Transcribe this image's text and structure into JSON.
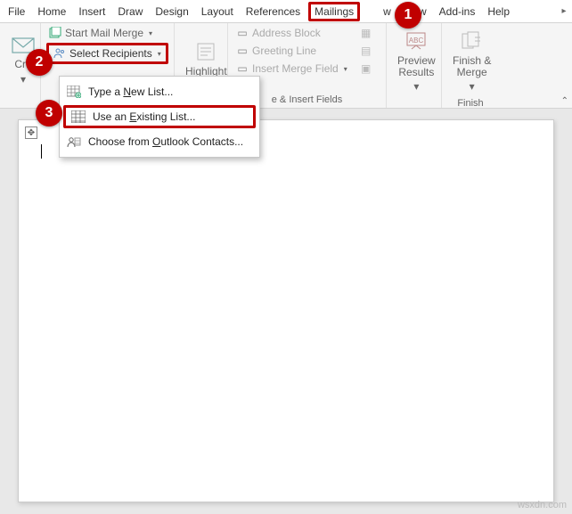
{
  "tabs": {
    "file": "File",
    "home": "Home",
    "insert": "Insert",
    "draw": "Draw",
    "design": "Design",
    "layout": "Layout",
    "references": "References",
    "mailings": "Mailings",
    "view_trunc": "w",
    "view": "View",
    "addins": "Add-ins",
    "help": "Help"
  },
  "ribbon": {
    "create": {
      "label": "Cre"
    },
    "start_group": {
      "start_mail_merge": "Start Mail Merge",
      "select_recipients": "Select Recipients",
      "title_trunc": "e & Insert Fields"
    },
    "highlight": "Highlight",
    "write": {
      "address_block": "Address Block",
      "greeting_line": "Greeting Line",
      "insert_merge_field": "Insert Merge Field"
    },
    "preview": {
      "label": "Preview\nResults",
      "title": ""
    },
    "finish": {
      "label": "Finish &\nMerge",
      "title": "Finish"
    }
  },
  "dropdown": {
    "type_new_pre": "Type a ",
    "type_new_u": "N",
    "type_new_post": "ew List...",
    "use_existing_pre": "Use an ",
    "use_existing_u": "E",
    "use_existing_post": "xisting List...",
    "outlook_pre": "Choose from ",
    "outlook_u": "O",
    "outlook_post": "utlook Contacts..."
  },
  "callouts": {
    "one": "1",
    "two": "2",
    "three": "3"
  },
  "watermark": "wsxdn.com"
}
